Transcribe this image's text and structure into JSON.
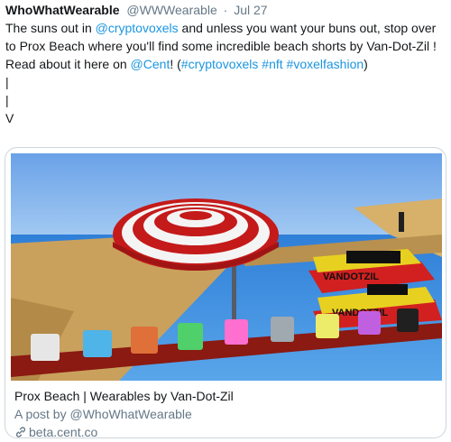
{
  "tweet": {
    "author_name": "WhoWhatWearable",
    "author_handle": "@WWWearable",
    "separator": "·",
    "date": "Jul 27",
    "line1": {
      "before": "The suns out in ",
      "mention": "@cryptovoxels",
      "after": " and unless you want your buns out, stop over to Prox Beach where you'll find some incredible beach shorts by Van-Dot-Zil !"
    },
    "line2": {
      "before": "Read about it here on ",
      "mention": "@Cent",
      "mid1": "! (",
      "tag1": "#cryptovoxels",
      "space1": " ",
      "tag2": "#nft",
      "space2": " ",
      "tag3": "#voxelfashion",
      "end": ")"
    },
    "arrow_lines": [
      "|",
      "|",
      "V"
    ]
  },
  "card": {
    "title": "Prox Beach | Wearables by Van-Dot-Zil",
    "description": "A post by @WhoWhatWearable",
    "domain": "beta.cent.co",
    "link_icon": "link-icon",
    "image": {
      "boat_label_1": "VANDOTZIL",
      "boat_label_2": "VANDOTZIL",
      "shorts_colors": [
        "#e6e6e6",
        "#4fb4e8",
        "#e0703a",
        "#4fd06a",
        "#ff6fd0",
        "#a0a8b0",
        "#ecec6a",
        "#c060e0",
        "#202020"
      ]
    }
  }
}
